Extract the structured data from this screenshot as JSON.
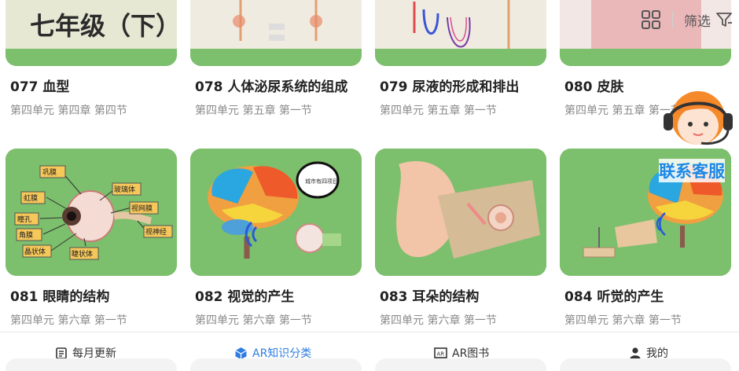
{
  "header": {
    "title": "七年级（下）",
    "filter_label": "筛选"
  },
  "cards": [
    {
      "title": "077 血型",
      "subtitle": "第四单元 第四章 第四节"
    },
    {
      "title": "078 人体泌尿系统的组成",
      "subtitle": "第四单元 第五章 第一节"
    },
    {
      "title": "079 尿液的形成和排出",
      "subtitle": "第四单元 第五章 第一节"
    },
    {
      "title": "080 皮肤",
      "subtitle": "第四单元 第五章 第一节"
    },
    {
      "title": "081 眼睛的结构",
      "subtitle": "第四单元 第六章 第一节",
      "labels": [
        "巩膜",
        "虹膜",
        "瞳孔",
        "角膜",
        "晶状体",
        "睫状体",
        "玻璃体",
        "视网膜",
        "视神经"
      ]
    },
    {
      "title": "082 视觉的产生",
      "subtitle": "第四单元 第六章 第一节",
      "bubble": "城市有四项目"
    },
    {
      "title": "083 耳朵的结构",
      "subtitle": "第四单元 第六章 第一节"
    },
    {
      "title": "084 听觉的产生",
      "subtitle": "第四单元 第六章 第一节"
    }
  ],
  "customer_service": {
    "label": "联系客服"
  },
  "tabs": [
    {
      "label": "每月更新",
      "icon": "calendar-icon"
    },
    {
      "label": "AR知识分类",
      "icon": "cube-icon",
      "active": true
    },
    {
      "label": "AR图书",
      "icon": "book-icon"
    },
    {
      "label": "我的",
      "icon": "person-icon"
    }
  ],
  "colors": {
    "card_bg": "#7cbf6c",
    "accent": "#2f7de1",
    "cs_blue": "#1e88e5"
  }
}
